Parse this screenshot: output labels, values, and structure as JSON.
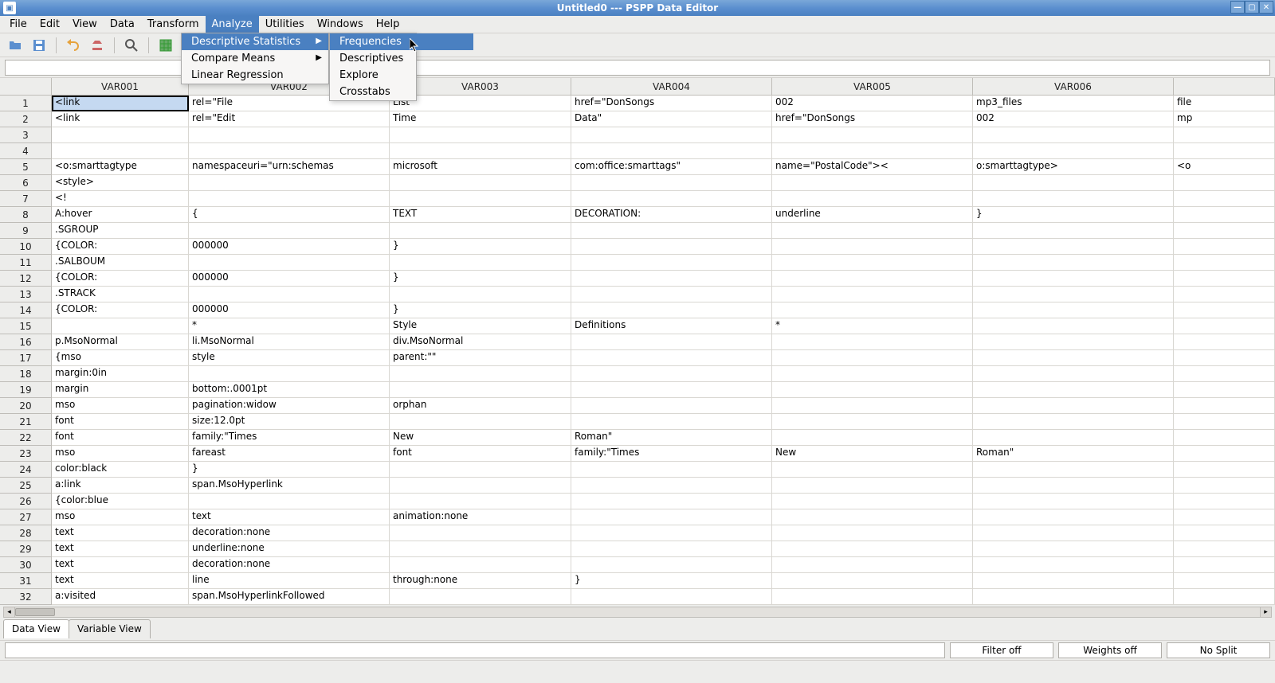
{
  "window": {
    "title": "Untitled0 --- PSPP Data Editor"
  },
  "menubar": {
    "items": [
      "File",
      "Edit",
      "View",
      "Data",
      "Transform",
      "Analyze",
      "Utilities",
      "Windows",
      "Help"
    ],
    "active_index": 5
  },
  "analyze_menu": {
    "items": [
      {
        "label": "Descriptive Statistics",
        "has_sub": true,
        "highlighted": true
      },
      {
        "label": "Compare Means",
        "has_sub": true,
        "highlighted": false
      },
      {
        "label": "Linear Regression",
        "has_sub": false,
        "highlighted": false
      }
    ]
  },
  "desc_submenu": {
    "items": [
      {
        "label": "Frequencies",
        "highlighted": true
      },
      {
        "label": "Descriptives",
        "highlighted": false
      },
      {
        "label": "Explore",
        "highlighted": false
      },
      {
        "label": "Crosstabs",
        "highlighted": false
      }
    ]
  },
  "columns": [
    "VAR001",
    "VAR002",
    "VAR003",
    "VAR004",
    "VAR005",
    "VAR006",
    ""
  ],
  "rows": [
    [
      "<link",
      "rel=\"File",
      "List\"",
      "href=\"DonSongs",
      "002",
      "mp3_files",
      "file"
    ],
    [
      "<link",
      "rel=\"Edit",
      "Time",
      "Data\"",
      "href=\"DonSongs",
      "002",
      "mp"
    ],
    [
      "",
      "",
      "",
      "",
      "",
      "",
      ""
    ],
    [
      "",
      "",
      "",
      "",
      "",
      "",
      ""
    ],
    [
      "<o:smarttagtype",
      "namespaceuri=\"urn:schemas",
      "microsoft",
      "com:office:smarttags\"",
      "name=\"PostalCode\"><",
      "o:smarttagtype>",
      "<o"
    ],
    [
      "<style>",
      "",
      "",
      "",
      "",
      "",
      ""
    ],
    [
      "<!",
      "",
      "",
      "",
      "",
      "",
      ""
    ],
    [
      "A:hover",
      "{",
      "TEXT",
      "DECORATION:",
      "underline",
      "}",
      ""
    ],
    [
      ".SGROUP",
      "",
      "",
      "",
      "",
      "",
      ""
    ],
    [
      "{COLOR:",
      "000000",
      "}",
      "",
      "",
      "",
      ""
    ],
    [
      ".SALBOUM",
      "",
      "",
      "",
      "",
      "",
      ""
    ],
    [
      "{COLOR:",
      "000000",
      "}",
      "",
      "",
      "",
      ""
    ],
    [
      ".STRACK",
      "",
      "",
      "",
      "",
      "",
      ""
    ],
    [
      "{COLOR:",
      "000000",
      "}",
      "",
      "",
      "",
      ""
    ],
    [
      "",
      "*",
      "Style",
      "Definitions",
      "*",
      "",
      ""
    ],
    [
      "p.MsoNormal",
      "li.MsoNormal",
      "div.MsoNormal",
      "",
      "",
      "",
      ""
    ],
    [
      "{mso",
      "style",
      "parent:\"\"",
      "",
      "",
      "",
      ""
    ],
    [
      "margin:0in",
      "",
      "",
      "",
      "",
      "",
      ""
    ],
    [
      "margin",
      "bottom:.0001pt",
      "",
      "",
      "",
      "",
      ""
    ],
    [
      "mso",
      "pagination:widow",
      "orphan",
      "",
      "",
      "",
      ""
    ],
    [
      "font",
      "size:12.0pt",
      "",
      "",
      "",
      "",
      ""
    ],
    [
      "font",
      "family:\"Times",
      "New",
      "Roman\"",
      "",
      "",
      ""
    ],
    [
      "mso",
      "fareast",
      "font",
      "family:\"Times",
      "New",
      "Roman\"",
      ""
    ],
    [
      "color:black",
      "}",
      "",
      "",
      "",
      "",
      ""
    ],
    [
      "a:link",
      "span.MsoHyperlink",
      "",
      "",
      "",
      "",
      ""
    ],
    [
      "{color:blue",
      "",
      "",
      "",
      "",
      "",
      ""
    ],
    [
      "mso",
      "text",
      "animation:none",
      "",
      "",
      "",
      ""
    ],
    [
      "text",
      "decoration:none",
      "",
      "",
      "",
      "",
      ""
    ],
    [
      "text",
      "underline:none",
      "",
      "",
      "",
      "",
      ""
    ],
    [
      "text",
      "decoration:none",
      "",
      "",
      "",
      "",
      ""
    ],
    [
      "text",
      "line",
      "through:none",
      "}",
      "",
      "",
      ""
    ],
    [
      "a:visited",
      "span.MsoHyperlinkFollowed",
      "",
      "",
      "",
      "",
      ""
    ]
  ],
  "selected_cell": {
    "row": 0,
    "col": 0
  },
  "tabs": {
    "items": [
      "Data View",
      "Variable View"
    ],
    "active_index": 0
  },
  "status": {
    "filter": "Filter off",
    "weights": "Weights off",
    "split": "No Split"
  },
  "toolbar_icons": [
    "open-icon",
    "save-icon",
    "undo-icon",
    "redo-icon",
    "find-icon",
    "goto-case-icon",
    "variables-icon",
    "insert-cases-icon"
  ]
}
